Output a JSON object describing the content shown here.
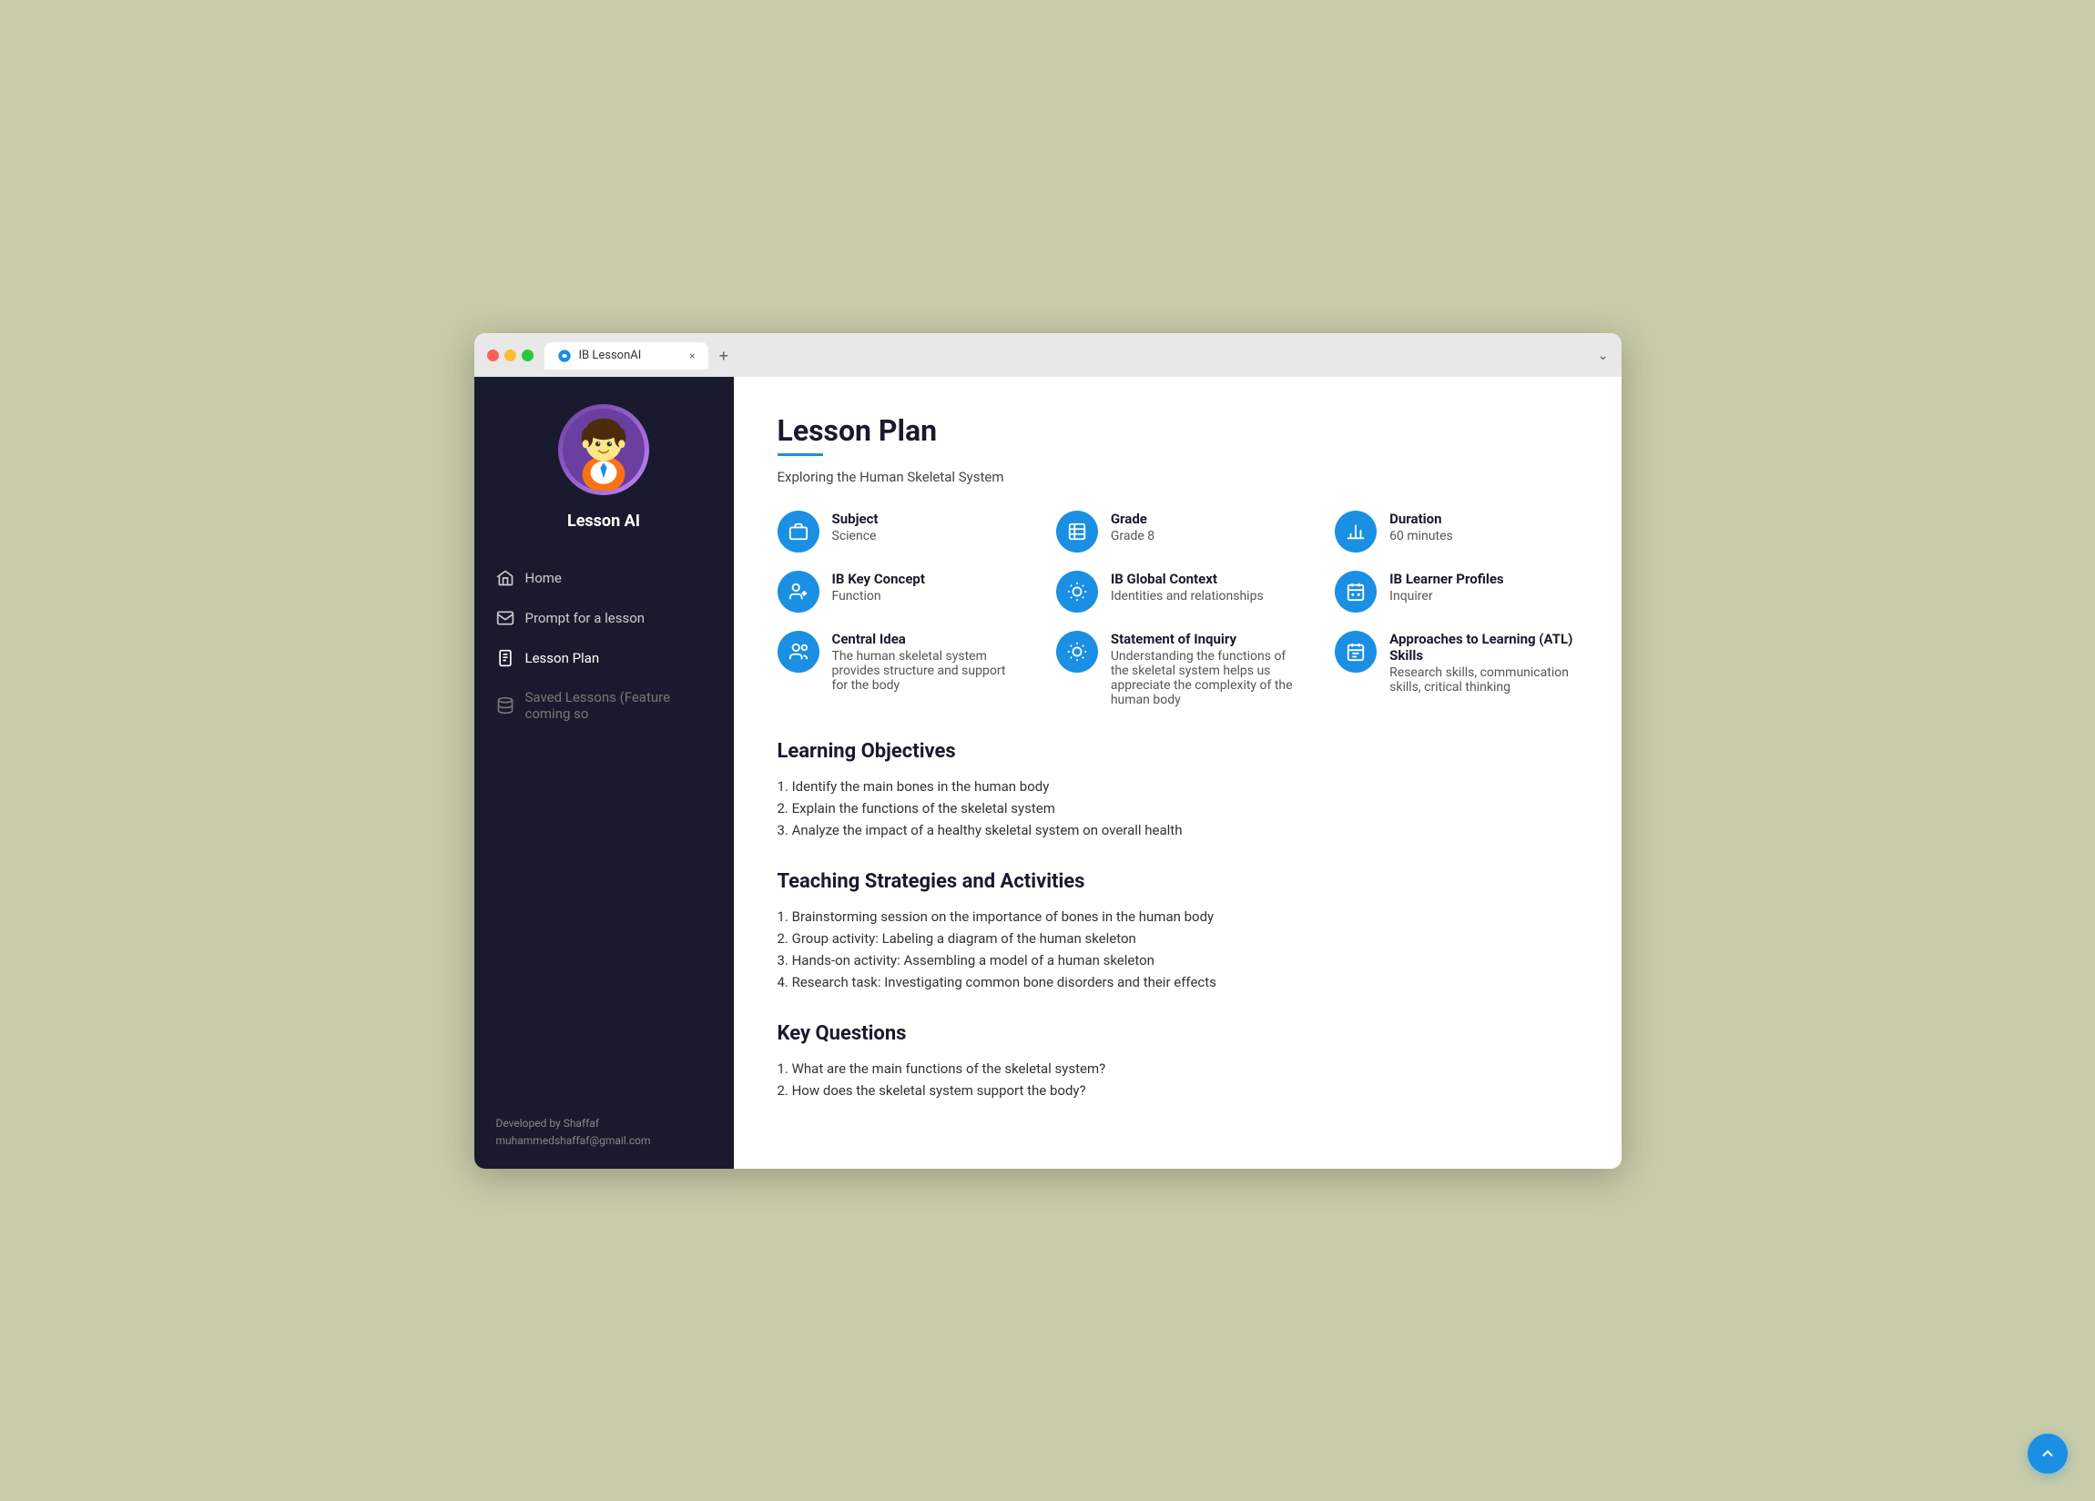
{
  "browser": {
    "tab_label": "IB LessonAI",
    "tab_close": "×",
    "tab_new": "+",
    "chevron": "⌄"
  },
  "sidebar": {
    "app_name": "Lesson AI",
    "nav_items": [
      {
        "id": "home",
        "label": "Home",
        "active": false
      },
      {
        "id": "prompt",
        "label": "Prompt for a lesson",
        "active": false
      },
      {
        "id": "lesson-plan",
        "label": "Lesson Plan",
        "active": true
      },
      {
        "id": "saved",
        "label": "Saved Lessons (Feature coming so",
        "active": false,
        "disabled": true
      }
    ],
    "footer_line1": "Developed by Shaffaf",
    "footer_line2": "muhammedshaffaf@gmail.com"
  },
  "main": {
    "page_title": "Lesson Plan",
    "subtitle": "Exploring the Human Skeletal System",
    "info_cards": [
      {
        "label": "Subject",
        "value": "Science",
        "icon": "briefcase"
      },
      {
        "label": "Grade",
        "value": "Grade 8",
        "icon": "document"
      },
      {
        "label": "Duration",
        "value": "60 minutes",
        "icon": "bar-chart"
      },
      {
        "label": "IB Key Concept",
        "value": "Function",
        "icon": "people"
      },
      {
        "label": "IB Global Context",
        "value": "Identities and relationships",
        "icon": "sun"
      },
      {
        "label": "IB Learner Profiles",
        "value": "Inquirer",
        "icon": "calendar"
      },
      {
        "label": "Central Idea",
        "value": "The human skeletal system provides structure and support for the body",
        "icon": "people2"
      },
      {
        "label": "Statement of Inquiry",
        "value": "Understanding the functions of the skeletal system helps us appreciate the complexity of the human body",
        "icon": "sun2"
      },
      {
        "label": "Approaches to Learning (ATL) Skills",
        "value": "Research skills, communication skills, critical thinking",
        "icon": "calendar2"
      }
    ],
    "sections": [
      {
        "title": "Learning Objectives",
        "items": [
          "1. Identify the main bones in the human body",
          "2. Explain the functions of the skeletal system",
          "3. Analyze the impact of a healthy skeletal system on overall health"
        ]
      },
      {
        "title": "Teaching Strategies and Activities",
        "items": [
          "1. Brainstorming session on the importance of bones in the human body",
          "2. Group activity: Labeling a diagram of the human skeleton",
          "3. Hands-on activity: Assembling a model of a human skeleton",
          "4. Research task: Investigating common bone disorders and their effects"
        ]
      },
      {
        "title": "Key Questions",
        "items": [
          "1. What are the main functions of the skeletal system?",
          "2. How does the skeletal system support the body?"
        ]
      }
    ]
  }
}
